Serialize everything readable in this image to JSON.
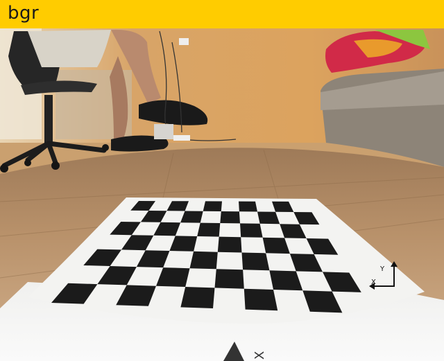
{
  "window": {
    "title": "bgr"
  },
  "camera_view": {
    "subject": "chessboard-calibration-pattern",
    "board": {
      "rows": 7,
      "cols": 10,
      "axis_labels": [
        "Y",
        "X"
      ]
    },
    "colors": {
      "titlebar": "#ffcc00",
      "wall": "#d9a260",
      "floor": "#b58c62",
      "paper": "#f4f4f2",
      "square": "#1b1b1b"
    }
  }
}
